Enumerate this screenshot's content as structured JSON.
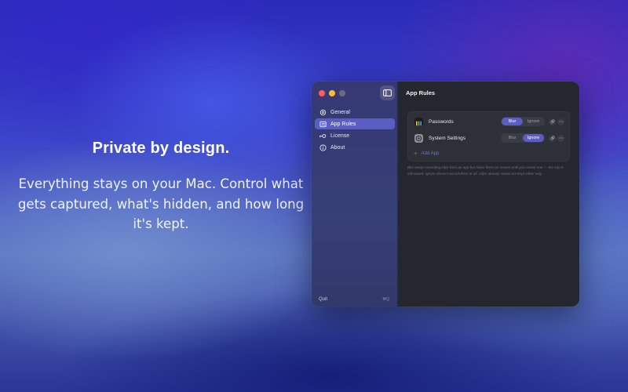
{
  "hero": {
    "title": "Private by design.",
    "subtitle": "Everything stays on your Mac. Control what gets captured, what's hidden, and how long it's kept."
  },
  "window": {
    "traffic_lights": [
      "close",
      "minimize",
      "maximize"
    ],
    "sidebar": {
      "toggle_icon": "sidebar-toggle-icon",
      "items": [
        {
          "label": "General",
          "icon": "gear-icon",
          "active": false
        },
        {
          "label": "App Rules",
          "icon": "list-icon",
          "active": true
        },
        {
          "label": "License",
          "icon": "key-icon",
          "active": false
        },
        {
          "label": "About",
          "icon": "info-icon",
          "active": false
        }
      ],
      "quit_label": "Quit",
      "quit_shortcut": "⌘Q"
    },
    "main": {
      "title": "App Rules",
      "rules": [
        {
          "app": "Passwords",
          "icon": "passwords-app-icon",
          "options": [
            "Blur",
            "Ignore"
          ],
          "selected": "Blur"
        },
        {
          "app": "System Settings",
          "icon": "system-settings-app-icon",
          "options": [
            "Blur",
            "Ignore"
          ],
          "selected": "Ignore"
        }
      ],
      "add_app_label": "Add App",
      "help_text": "Blur keeps recording clips from an app but hides them on screen until you reveal one — the clip is still saved. Ignore doesn't record them at all. Clips already saved are kept either way."
    },
    "colors": {
      "accent": "#5a5ec2",
      "window_bg": "#25272f",
      "sidebar_bg": "#3a4280"
    }
  }
}
